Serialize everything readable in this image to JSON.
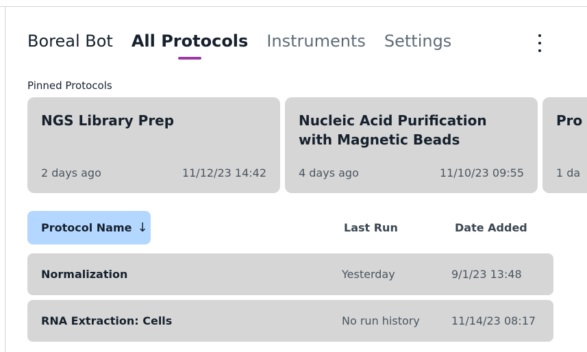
{
  "nav": {
    "tabs": [
      {
        "label": "Boreal Bot"
      },
      {
        "label": "All Protocols"
      },
      {
        "label": "Instruments"
      },
      {
        "label": "Settings"
      }
    ],
    "active_tab": "All Protocols",
    "more_icon": "vertical-ellipsis-icon"
  },
  "pinned": {
    "label": "Pinned Protocols",
    "cards": [
      {
        "title": "NGS Library Prep",
        "last_run": "2 days ago",
        "date": "11/12/23 14:42"
      },
      {
        "title": "Nucleic Acid Purification with Magnetic Beads",
        "last_run": "4 days ago",
        "date": "11/10/23 09:55"
      },
      {
        "title": "Pro",
        "last_run": "1 da",
        "date": ""
      }
    ]
  },
  "table": {
    "sort_label": "Protocol Name",
    "sort_icon": "arrow-down-icon",
    "sort_glyph": "↓",
    "columns": {
      "last_run": "Last Run",
      "date_added": "Date Added"
    },
    "rows": [
      {
        "name": "Normalization",
        "last_run": "Yesterday",
        "date_added": "9/1/23 13:48"
      },
      {
        "name": "RNA Extraction: Cells",
        "last_run": "No run history",
        "date_added": "11/14/23 08:17"
      }
    ]
  },
  "colors": {
    "accent_underline": "#9c3ba8",
    "sort_button_bg": "#b3d7ff",
    "card_bg": "#d6d6d6",
    "text_primary": "#16212d"
  }
}
